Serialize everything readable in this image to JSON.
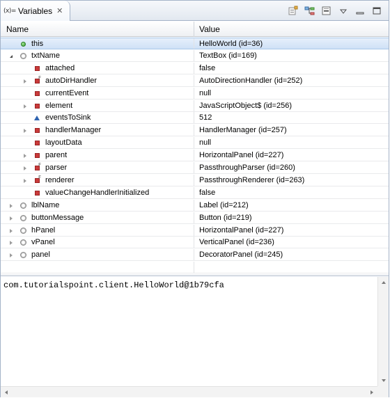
{
  "tab": {
    "icon_text": "(x)=",
    "title": "Variables",
    "close_icon": "close-icon"
  },
  "toolbar": {
    "buttons": [
      {
        "icon": "show-type-names-icon"
      },
      {
        "icon": "show-logical-structure-icon"
      },
      {
        "icon": "collapse-all-icon"
      },
      {
        "icon": "view-menu-icon"
      },
      {
        "icon": "minimize-icon"
      },
      {
        "icon": "maximize-icon"
      }
    ]
  },
  "columns": {
    "name": "Name",
    "value": "Value"
  },
  "rows": [
    {
      "name": "this",
      "value": "HelloWorld  (id=36)",
      "icon": "green-dot",
      "twisty": "none",
      "level": 0,
      "selected": true
    },
    {
      "name": "txtName",
      "value": "TextBox  (id=169)",
      "icon": "gray-field",
      "twisty": "expanded",
      "level": 0
    },
    {
      "name": "attached",
      "value": "false",
      "icon": "red-square",
      "twisty": "none",
      "level": 1
    },
    {
      "name": "autoDirHandler",
      "value": "AutoDirectionHandler  (id=252)",
      "icon": "red-square-final",
      "twisty": "collapsed",
      "level": 1
    },
    {
      "name": "currentEvent",
      "value": "null",
      "icon": "red-square",
      "twisty": "none",
      "level": 1
    },
    {
      "name": "element",
      "value": "JavaScriptObject$  (id=256)",
      "icon": "red-square",
      "twisty": "collapsed",
      "level": 1
    },
    {
      "name": "eventsToSink",
      "value": "512",
      "icon": "blue-triangle",
      "twisty": "none",
      "level": 1
    },
    {
      "name": "handlerManager",
      "value": "HandlerManager  (id=257)",
      "icon": "red-square",
      "twisty": "collapsed",
      "level": 1
    },
    {
      "name": "layoutData",
      "value": "null",
      "icon": "red-square",
      "twisty": "none",
      "level": 1
    },
    {
      "name": "parent",
      "value": "HorizontalPanel  (id=227)",
      "icon": "red-square",
      "twisty": "collapsed",
      "level": 1
    },
    {
      "name": "parser",
      "value": "PassthroughParser  (id=260)",
      "icon": "red-square-final",
      "twisty": "collapsed",
      "level": 1
    },
    {
      "name": "renderer",
      "value": "PassthroughRenderer  (id=263)",
      "icon": "red-square-final",
      "twisty": "collapsed",
      "level": 1
    },
    {
      "name": "valueChangeHandlerInitialized",
      "value": "false",
      "icon": "red-square",
      "twisty": "none",
      "level": 1
    },
    {
      "name": "lblName",
      "value": "Label  (id=212)",
      "icon": "gray-field",
      "twisty": "collapsed",
      "level": 0
    },
    {
      "name": "buttonMessage",
      "value": "Button  (id=219)",
      "icon": "gray-field",
      "twisty": "collapsed",
      "level": 0
    },
    {
      "name": "hPanel",
      "value": "HorizontalPanel  (id=227)",
      "icon": "gray-field",
      "twisty": "collapsed",
      "level": 0
    },
    {
      "name": "vPanel",
      "value": "VerticalPanel  (id=236)",
      "icon": "gray-field",
      "twisty": "collapsed",
      "level": 0
    },
    {
      "name": "panel",
      "value": "DecoratorPanel  (id=245)",
      "icon": "gray-field",
      "twisty": "collapsed",
      "level": 0
    }
  ],
  "detail": {
    "text": "com.tutorialspoint.client.HelloWorld@1b79cfa"
  },
  "colors": {
    "selection": "#cfe1f6",
    "border": "#a4b3c8",
    "field_red": "#c93b3b",
    "local_green": "#2f9a2b",
    "static_blue": "#2f64b0"
  }
}
